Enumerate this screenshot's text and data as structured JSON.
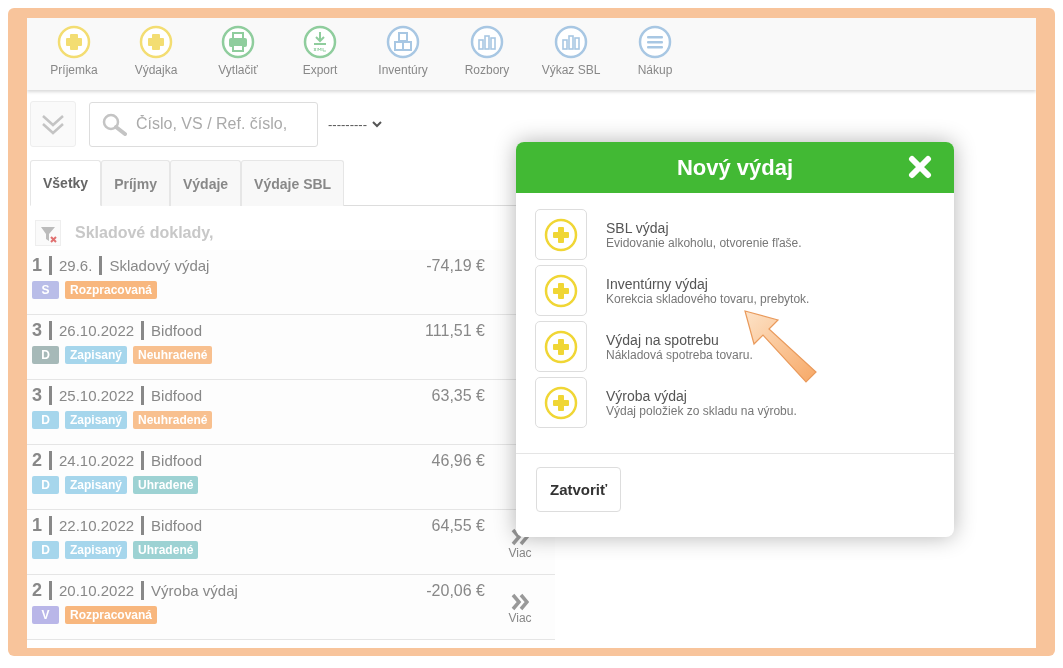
{
  "toolbar": [
    {
      "label": "Príjemka",
      "kind": "plus"
    },
    {
      "label": "Výdajka",
      "kind": "plus"
    },
    {
      "label": "Vytlačiť",
      "kind": "printer"
    },
    {
      "label": "Export",
      "kind": "export"
    },
    {
      "label": "Inventúry",
      "kind": "boxes"
    },
    {
      "label": "Rozbory",
      "kind": "bars"
    },
    {
      "label": "Výkaz SBL",
      "kind": "bars"
    },
    {
      "label": "Nákup",
      "kind": "menu"
    }
  ],
  "search": {
    "placeholder": "Číslo, VS / Ref. číslo,"
  },
  "filter_select": {
    "value": "---------"
  },
  "tabs": [
    {
      "label": "Všetky",
      "selected": true
    },
    {
      "label": "Príjmy",
      "selected": false
    },
    {
      "label": "Výdaje",
      "selected": false
    },
    {
      "label": "Výdaje SBL",
      "selected": false
    }
  ],
  "list_heading": "Skladové doklady,",
  "rows": [
    {
      "count": "1",
      "date": "29.6.",
      "name": "Skladový výdaj",
      "amount": "-74,19 €",
      "badges": [
        {
          "text": "S",
          "color": "#b9bde8"
        },
        {
          "text": "Rozpracovaná",
          "color": "#f8b77e"
        }
      ]
    },
    {
      "count": "3",
      "date": "26.10.2022",
      "name": "Bidfood",
      "amount": "111,51 €",
      "badges": [
        {
          "text": "D",
          "color": "#a6b9b8"
        },
        {
          "text": "Zapisaný",
          "color": "#a6d6ec"
        },
        {
          "text": "Neuhradené",
          "color": "#f8c08f"
        }
      ]
    },
    {
      "count": "3",
      "date": "25.10.2022",
      "name": "Bidfood",
      "amount": "63,35 €",
      "badges": [
        {
          "text": "D",
          "color": "#a6d6ec"
        },
        {
          "text": "Zapisaný",
          "color": "#a6d6ec"
        },
        {
          "text": "Neuhradené",
          "color": "#f8c08f"
        }
      ]
    },
    {
      "count": "2",
      "date": "24.10.2022",
      "name": "Bidfood",
      "amount": "46,96 €",
      "badges": [
        {
          "text": "D",
          "color": "#a6d6ec"
        },
        {
          "text": "Zapisaný",
          "color": "#a6d6ec"
        },
        {
          "text": "Uhradené",
          "color": "#9dd2d3"
        }
      ]
    },
    {
      "count": "1",
      "date": "22.10.2022",
      "name": "Bidfood",
      "amount": "64,55 €",
      "more": "Viac",
      "badges": [
        {
          "text": "D",
          "color": "#a6d6ec"
        },
        {
          "text": "Zapisaný",
          "color": "#a6d6ec"
        },
        {
          "text": "Uhradené",
          "color": "#9dd2d3"
        }
      ]
    },
    {
      "count": "2",
      "date": "20.10.2022",
      "name": "Výroba výdaj",
      "amount": "-20,06 €",
      "more": "Viac",
      "badges": [
        {
          "text": "V",
          "color": "#b9b6e8"
        },
        {
          "text": "Rozpracovaná",
          "color": "#f8b77e"
        }
      ]
    }
  ],
  "dialog": {
    "title": "Nový výdaj",
    "options": [
      {
        "label": "SBL výdaj",
        "description": "Evidovanie alkoholu, otvorenie fľaše."
      },
      {
        "label": "Inventúrny výdaj",
        "description": "Korekcia skladového tovaru, prebytok."
      },
      {
        "label": "Výdaj na spotrebu",
        "description": "Nákladová spotreba tovaru."
      },
      {
        "label": "Výroba výdaj",
        "description": "Výdaj položiek zo skladu na výrobu."
      }
    ],
    "close_button": "Zatvoriť"
  }
}
